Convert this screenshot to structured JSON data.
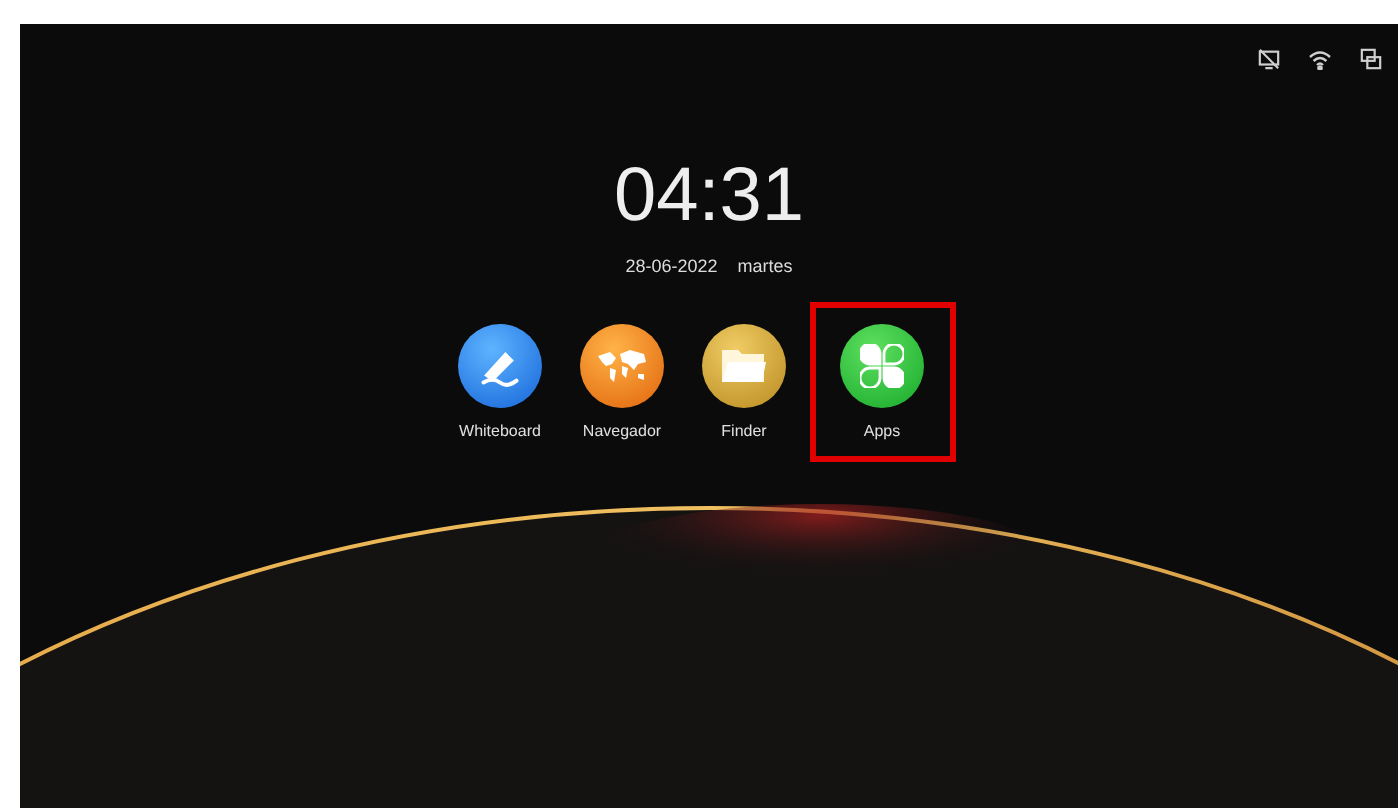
{
  "clock": {
    "time": "04:31",
    "date": "28-06-2022",
    "weekday": "martes"
  },
  "apps": [
    {
      "label": "Whiteboard",
      "kind": "whiteboard",
      "highlighted": false
    },
    {
      "label": "Navegador",
      "kind": "browser",
      "highlighted": false
    },
    {
      "label": "Finder",
      "kind": "folder",
      "highlighted": false
    },
    {
      "label": "Apps",
      "kind": "apps",
      "highlighted": true
    }
  ]
}
